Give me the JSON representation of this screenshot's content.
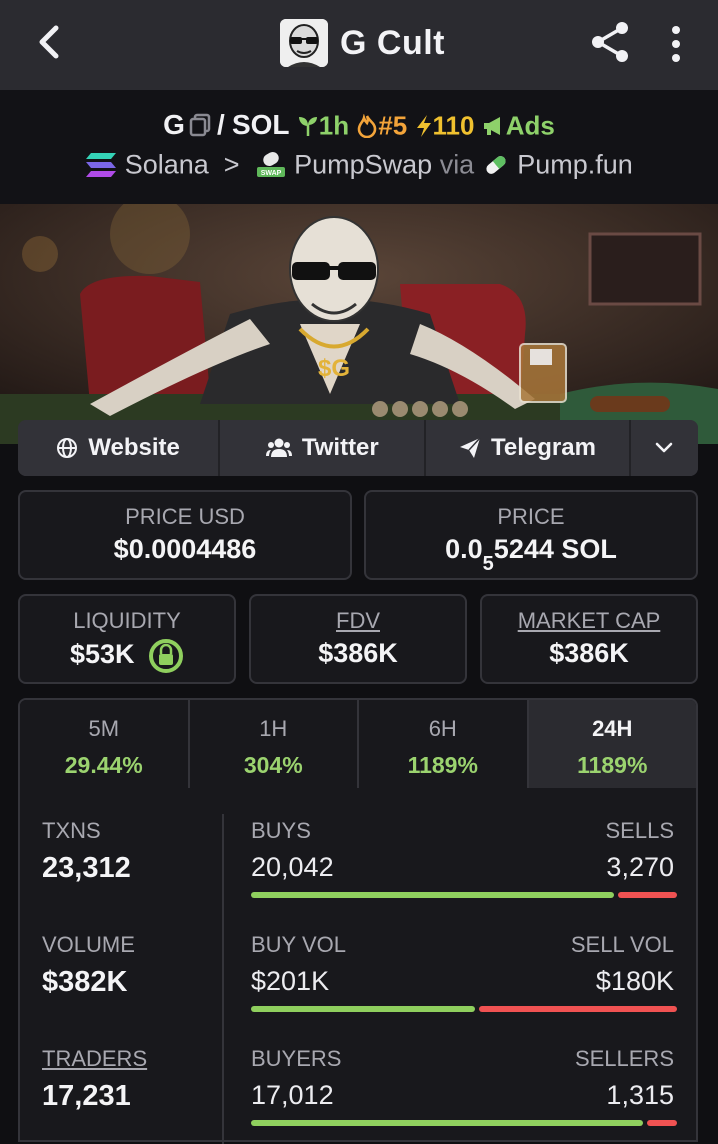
{
  "topbar": {
    "title": "G Cult"
  },
  "pair": {
    "base": "G",
    "quote": "SOL",
    "separator": "/",
    "age": "1h",
    "rank": "#5",
    "boosts": "110",
    "ads": "Ads"
  },
  "chain": {
    "name": "Solana",
    "dex": "PumpSwap",
    "via": "via",
    "launchpad": "Pump.fun"
  },
  "links": {
    "website": "Website",
    "twitter": "Twitter",
    "telegram": "Telegram"
  },
  "prices": {
    "usd_label": "PRICE USD",
    "usd_value": "$0.0004486",
    "native_label": "PRICE",
    "native_prefix": "0.0",
    "native_zeros": "5",
    "native_rest": "5244 SOL"
  },
  "metrics": {
    "liquidity_label": "LIQUIDITY",
    "liquidity_value": "$53K",
    "fdv_label": "FDV",
    "fdv_value": "$386K",
    "mcap_label": "MARKET CAP",
    "mcap_value": "$386K"
  },
  "tabs": [
    {
      "label": "5M",
      "change": "29.44%"
    },
    {
      "label": "1H",
      "change": "304%"
    },
    {
      "label": "6H",
      "change": "1189%"
    },
    {
      "label": "24H",
      "change": "1189%"
    }
  ],
  "stats": {
    "txns_label": "TXNS",
    "txns_value": "23,312",
    "buys_label": "BUYS",
    "buys_value": "20,042",
    "sells_label": "SELLS",
    "sells_value": "3,270",
    "volume_label": "VOLUME",
    "volume_value": "$382K",
    "buy_vol_label": "BUY VOL",
    "buy_vol_value": "$201K",
    "sell_vol_label": "SELL VOL",
    "sell_vol_value": "$180K",
    "traders_label": "TRADERS",
    "traders_value": "17,231",
    "buyers_label": "BUYERS",
    "buyers_value": "17,012",
    "sellers_label": "SELLERS",
    "sellers_value": "1,315",
    "buy_share": 0.86,
    "buy_vol_share": 0.53,
    "buyer_share": 0.93
  },
  "colors": {
    "positive": "#8fcf5e",
    "negative": "#f05252",
    "panel": "#18181c",
    "border": "#34343a"
  },
  "icons": [
    "back-icon",
    "share-icon",
    "more-icon",
    "copy-icon",
    "seedling-icon",
    "fire-icon",
    "bolt-icon",
    "megaphone-icon",
    "solana-icon",
    "pumpswap-icon",
    "pill-icon",
    "globe-icon",
    "users-icon",
    "send-icon",
    "chevron-down-icon",
    "lock-icon"
  ]
}
